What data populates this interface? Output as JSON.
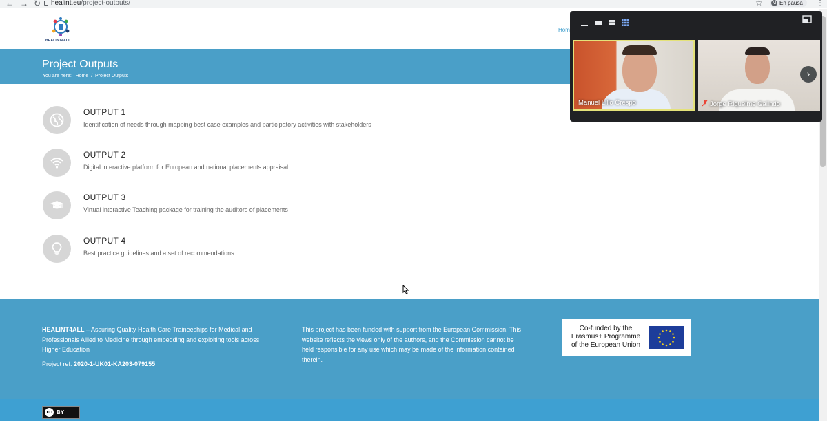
{
  "browser": {
    "url_domain": "healint.eu",
    "url_path": "/project-outputs/",
    "profile_initial": "M",
    "profile_status": "En pausa"
  },
  "site": {
    "logo_text": "HEALINT4ALL",
    "nav_home": "Hom"
  },
  "title_band": {
    "title": "Project Outputs",
    "crumb_prefix": "You are here:",
    "crumb_home": "Home",
    "crumb_sep": "/",
    "crumb_current": "Project Outputs"
  },
  "outputs": [
    {
      "title": "OUTPUT 1",
      "desc": "Identification of needs through mapping best case examples and participatory activities with stakeholders",
      "icon": "globe-icon"
    },
    {
      "title": "OUTPUT 2",
      "desc": "Digital interactive platform for European and national placements appraisal",
      "icon": "wifi-icon"
    },
    {
      "title": "OUTPUT 3",
      "desc": "Virtual interactive Teaching package for training the auditors of placements",
      "icon": "graduation-cap-icon"
    },
    {
      "title": "OUTPUT 4",
      "desc": "Best practice guidelines and a set of recommendations",
      "icon": "lightbulb-icon"
    }
  ],
  "footer": {
    "project_name": "HEALINT4ALL",
    "project_desc": " – Assuring Quality Health Care Traineeships for Medical and Professionals Allied to Medicine through embedding and exploiting tools across Higher Education",
    "ref_label": "Project ref: ",
    "ref_value": "2020-1-UK01-KA203-079155",
    "disclaimer": "This project has been funded with support from the European Commission. This website reflects the views only of the authors, and the Commission cannot be held responsible for any use which may be made of the information contained therein.",
    "erasmus_line1": "Co-funded by the",
    "erasmus_line2": "Erasmus+ Programme",
    "erasmus_line3": "of the European Union",
    "cc_label": "cc",
    "cc_by": "BY"
  },
  "video_call": {
    "participants": [
      {
        "name": "Manuel Lillo Crespo"
      },
      {
        "name": "Jorge Riquelme Galindo"
      }
    ]
  },
  "colors": {
    "band": "#4a9fc8",
    "accent": "#3a9ccc",
    "icon_bg": "#d6d6d6"
  }
}
